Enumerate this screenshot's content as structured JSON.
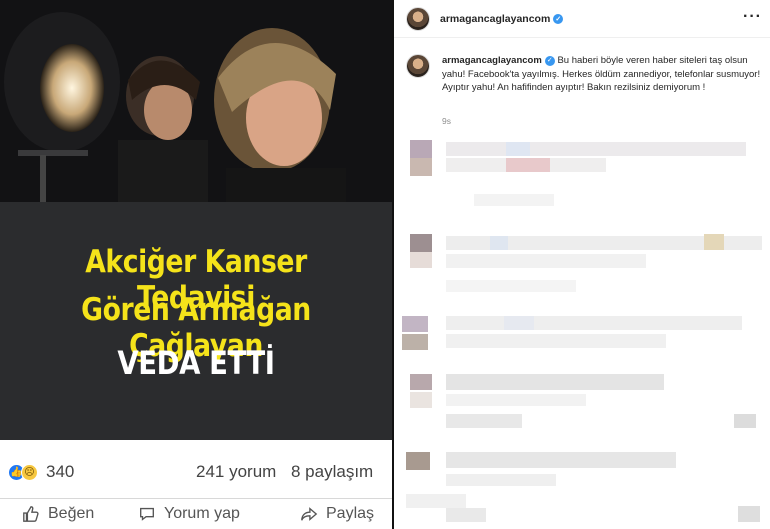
{
  "facebook_post": {
    "headline_line1": "Akciğer Kanser Tedavisi",
    "headline_line2": "Gören Armağan Çağlayan",
    "headline_line3": "VEDA ETTİ",
    "reaction_count": "340",
    "comments": "241 yorum",
    "shares": "8 paylaşım",
    "actions": {
      "like": "Beğen",
      "comment": "Yorum yap",
      "share": "Paylaş"
    }
  },
  "instagram_post": {
    "header_username": "armagancaglayancom",
    "caption_username": "armagancaglayancom",
    "caption_text": "Bu haberi böyle veren haber siteleri taş olsun yahu! Facebook'ta yayılmış. Herkes öldüm zannediyor, telefonlar susmuyor! Ayıptır yahu! An hafifinden ayıptır! Bakın rezilsiniz demiyorum !",
    "timestamp": "9s",
    "more_icon": "more-options-icon",
    "verified_icon": "verified-badge-icon"
  },
  "colors": {
    "banner_bg": "#2b2c2e",
    "banner_yellow": "#f5e31a",
    "fb_like_blue": "#2078f4",
    "ig_verified_blue": "#3897f0"
  }
}
